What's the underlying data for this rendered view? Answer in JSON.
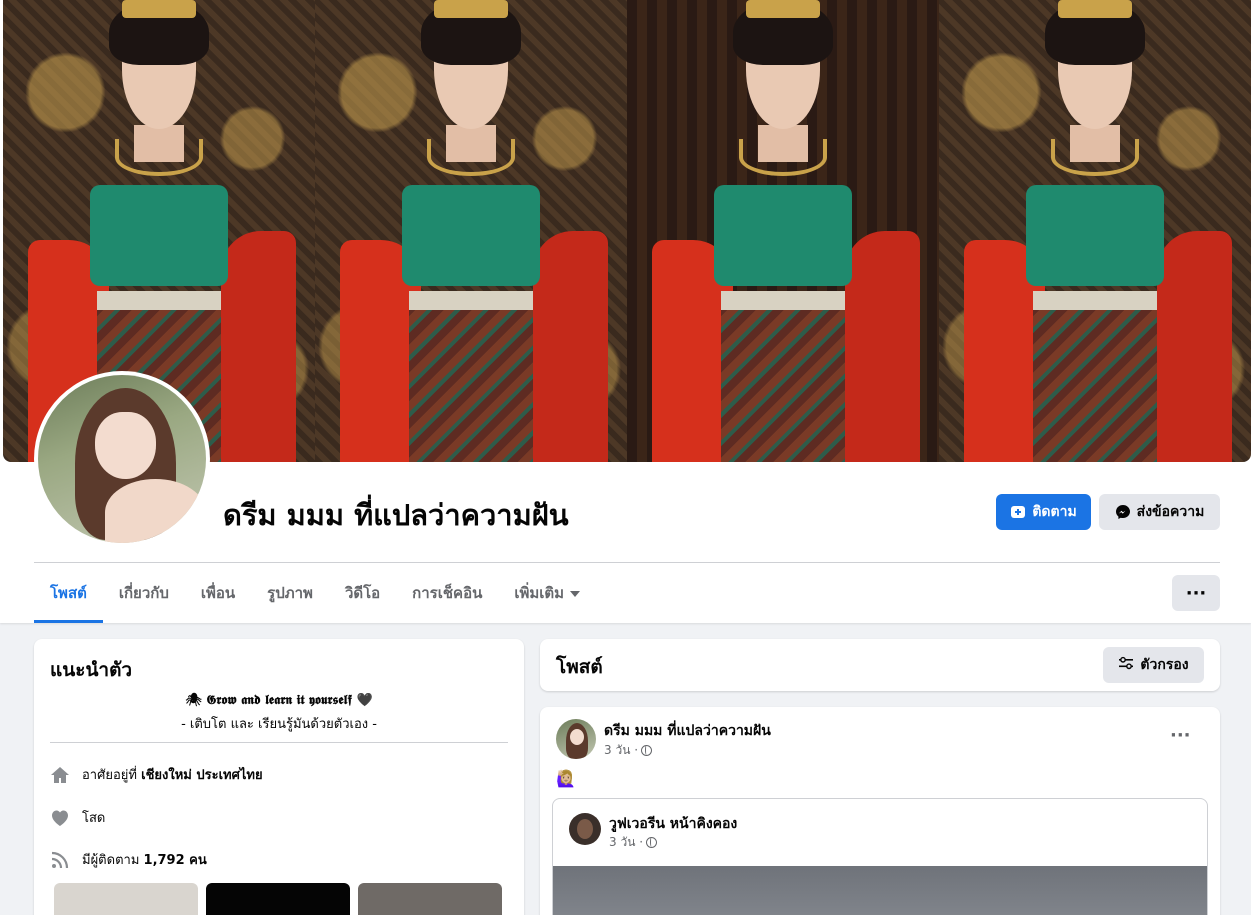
{
  "profile": {
    "name": "ดรีม มมม ที่แปลว่าความฝัน",
    "follow_label": "ติดตาม",
    "message_label": "ส่งข้อความ"
  },
  "tabs": [
    {
      "label": "โพสต์",
      "active": true
    },
    {
      "label": "เกี่ยวกับ"
    },
    {
      "label": "เพื่อน"
    },
    {
      "label": "รูปภาพ"
    },
    {
      "label": "วิดีโอ"
    },
    {
      "label": "การเช็คอิน"
    },
    {
      "label": "เพิ่มเติม"
    }
  ],
  "more_label": "···",
  "intro": {
    "title": "แนะนำตัว",
    "bio_line1": "🕷 𝕲𝖗𝖔𝖜 𝖆𝖓𝖉 𝖑𝖊𝖆𝖗𝖓 𝖎𝖙 𝖞𝖔𝖚𝖗𝖘𝖊𝖑𝖋 🖤",
    "bio_line2": "- เติบโต และ เรียนรู้มันด้วยตัวเอง -",
    "lives_prefix": "อาศัยอยู่ที่",
    "lives_place": "เชียงใหม่ ประเทศไทย",
    "relationship": "โสด",
    "followers_prefix": "มีผู้ติดตาม",
    "followers_count": "1,792 คน"
  },
  "posts_header": {
    "title": "โพสต์",
    "filter_label": "ตัวกรอง"
  },
  "post": {
    "author": "ดรีม มมม ที่แปลว่าความฝัน",
    "time": "3 วัน ·",
    "emoji": "🙋🏼‍♀️",
    "more": "···",
    "shared": {
      "author": "วูฟเวอรีน หน้าคิงคอง",
      "time": "3 วัน ·"
    }
  },
  "colors": {
    "accent": "#1b74e4",
    "background": "#f0f2f5",
    "secondary_text": "#65676b",
    "button_gray": "#e4e6eb"
  },
  "icons": {
    "follow": "add-person-icon",
    "message": "messenger-icon",
    "home": "home-icon",
    "heart": "heart-icon",
    "rss": "followers-rss-icon",
    "filter": "filter-sliders-icon",
    "globe": "globe-icon"
  }
}
